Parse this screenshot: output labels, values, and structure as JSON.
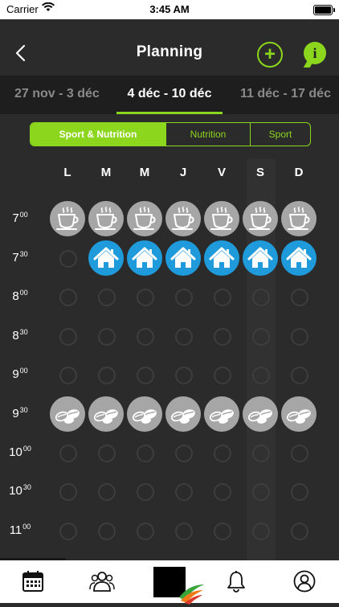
{
  "status_bar": {
    "carrier": "Carrier",
    "time": "3:45 AM"
  },
  "header": {
    "title": "Planning"
  },
  "weeks": {
    "previous": "27 nov - 3 déc",
    "current": "4 déc - 10 déc",
    "next": "11 déc - 17 déc"
  },
  "filter": {
    "options": [
      "Sport & Nutrition",
      "Nutrition",
      "Sport"
    ],
    "selected": "Sport & Nutrition"
  },
  "days": [
    "L",
    "M",
    "M",
    "J",
    "V",
    "S",
    "D"
  ],
  "times": [
    {
      "hour": "7",
      "minutes": "00"
    },
    {
      "hour": "7",
      "minutes": "30"
    },
    {
      "hour": "8",
      "minutes": "00"
    },
    {
      "hour": "8",
      "minutes": "30"
    },
    {
      "hour": "9",
      "minutes": "00"
    },
    {
      "hour": "9",
      "minutes": "30"
    },
    {
      "hour": "10",
      "minutes": "00"
    },
    {
      "hour": "10",
      "minutes": "30"
    },
    {
      "hour": "11",
      "minutes": "00"
    }
  ],
  "grid": [
    [
      "coffee",
      "coffee",
      "coffee",
      "coffee",
      "coffee",
      "coffee",
      "coffee"
    ],
    [
      "empty",
      "home",
      "home",
      "home",
      "home",
      "home",
      "home"
    ],
    [
      "empty",
      "empty",
      "empty",
      "empty",
      "empty",
      "empty",
      "empty"
    ],
    [
      "empty",
      "empty",
      "empty",
      "empty",
      "empty",
      "empty",
      "empty"
    ],
    [
      "empty",
      "empty",
      "empty",
      "empty",
      "empty",
      "empty",
      "empty"
    ],
    [
      "nuts",
      "nuts",
      "nuts",
      "nuts",
      "nuts",
      "nuts",
      "nuts"
    ],
    [
      "empty",
      "empty",
      "empty",
      "empty",
      "empty",
      "empty",
      "empty"
    ],
    [
      "empty",
      "empty",
      "empty",
      "empty",
      "empty",
      "empty",
      "empty"
    ],
    [
      "empty",
      "empty",
      "empty",
      "empty",
      "empty",
      "empty",
      "empty"
    ]
  ],
  "highlighted_day_index": 5,
  "tabs": [
    "calendar-icon",
    "group-icon",
    "app-logo",
    "bell-icon",
    "profile-icon"
  ],
  "colors": {
    "accent": "#8cd61e",
    "home": "#1f9bdc",
    "meal": "#a6a6a6",
    "background": "#2b2b2b"
  }
}
